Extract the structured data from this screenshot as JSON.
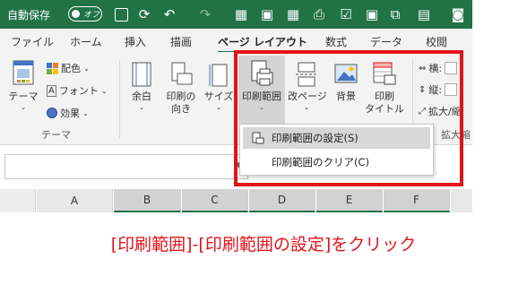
{
  "title_bar": {
    "autosave_label": "自動保存",
    "autosave_state": "オフ",
    "quick_access_icons": [
      "save-icon",
      "refresh-icon",
      "undo-icon",
      "redo-icon",
      "table-icon",
      "frame-icon",
      "grid-icon",
      "print-icon",
      "check-icon",
      "picture-icon",
      "copy-icon",
      "camera-icon"
    ]
  },
  "tabs": [
    "ファイル",
    "ホーム",
    "挿入",
    "描画",
    "ページ レイアウト",
    "数式",
    "データ",
    "校閲"
  ],
  "active_tab": "ページ レイアウト",
  "ribbon": {
    "theme_group": {
      "theme_button": "テーマ",
      "colors": "配色",
      "fonts": "フォント",
      "effects": "効果",
      "group_label": "テーマ"
    },
    "page_setup": {
      "margins": "余白",
      "orientation_line1": "印刷の",
      "orientation_line2": "向き",
      "size": "サイズ",
      "print_area": "印刷範囲",
      "breaks": "改ページ",
      "background": "背景",
      "print_titles_line1": "印刷",
      "print_titles_line2": "タイトル"
    },
    "scale": {
      "width": "横:",
      "height": "縦:",
      "scale": "拡大/縮",
      "group_label": "拡大縮"
    }
  },
  "dropdown": {
    "items": [
      "印刷範囲の設定(S)",
      "印刷範囲のクリア(C)"
    ]
  },
  "columns": [
    "A",
    "B",
    "C",
    "D",
    "E",
    "F"
  ],
  "caption": "[印刷範囲]-[印刷範囲の設定]をクリック",
  "colors": {
    "accent": "#217346",
    "highlight": "#e3131b"
  }
}
